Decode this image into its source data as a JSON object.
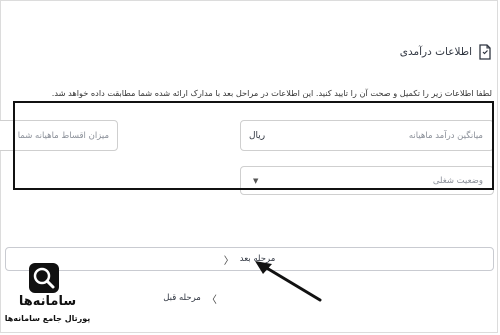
{
  "section": {
    "title": "اطلاعات درآمدی",
    "icon": "document-icon",
    "instruction": "لطفا اطلاعات زیر را تکمیل و صحت آن را تایید کنید. این اطلاعات در مراحل بعد با مدارک ارائه شده شما مطابقت داده خواهد شد."
  },
  "form": {
    "income_placeholder": "میانگین درآمد ماهیانه",
    "income_unit": "ریال",
    "installment_placeholder": "میزان اقساط ماهیانه شما",
    "job_status_placeholder": "وضعیت شغلی"
  },
  "nav": {
    "next_label": "مرحله بعد",
    "prev_label": "مرحله قبل"
  },
  "logo": {
    "name": "سامانه‌ها",
    "tagline": "پورتال جامع سامانه‌ها"
  },
  "colors": {
    "highlight_border": "#111111",
    "field_border": "#cfcfcf",
    "text": "#2f3540"
  }
}
